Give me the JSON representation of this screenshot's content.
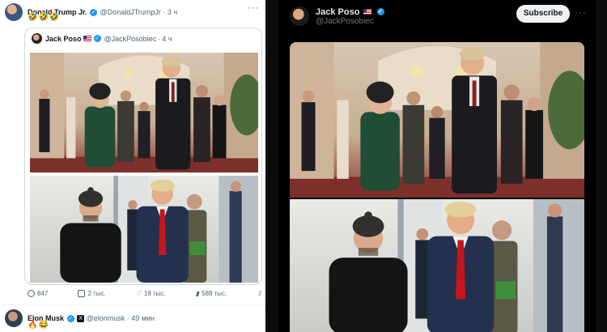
{
  "left_post": {
    "author_name": "Donald Trump Jr.",
    "author_handle": "@DonaldJTrumpJr",
    "time": "3 ч",
    "text": "🤣🤣🤣",
    "quoted": {
      "author_name": "Jack Poso",
      "author_handle": "@JackPosobiec",
      "time": "4 ч"
    },
    "actions": {
      "replies": "847",
      "reposts": "2 тыс.",
      "likes": "18 тыс.",
      "views": "588 тыс."
    }
  },
  "reply": {
    "author_name": "Elon Musk",
    "author_handle": "@elonmusk",
    "time": "49 мин",
    "text": "🔥😂"
  },
  "right_post": {
    "author_name": "Jack Poso",
    "author_handle": "@JackPosobiec",
    "subscribe_label": "Subscribe",
    "more_label": "···"
  },
  "icons": {
    "verified": "verified-badge-icon",
    "flag": "us-flag-icon",
    "reply": "reply-icon",
    "repost": "repost-icon",
    "like": "heart-icon",
    "views": "views-icon",
    "share": "share-icon",
    "x_badge": "x-badge-icon"
  },
  "colors": {
    "verified": "#1d9bf0",
    "dark_bg": "#000000",
    "light_bg": "#ffffff"
  }
}
